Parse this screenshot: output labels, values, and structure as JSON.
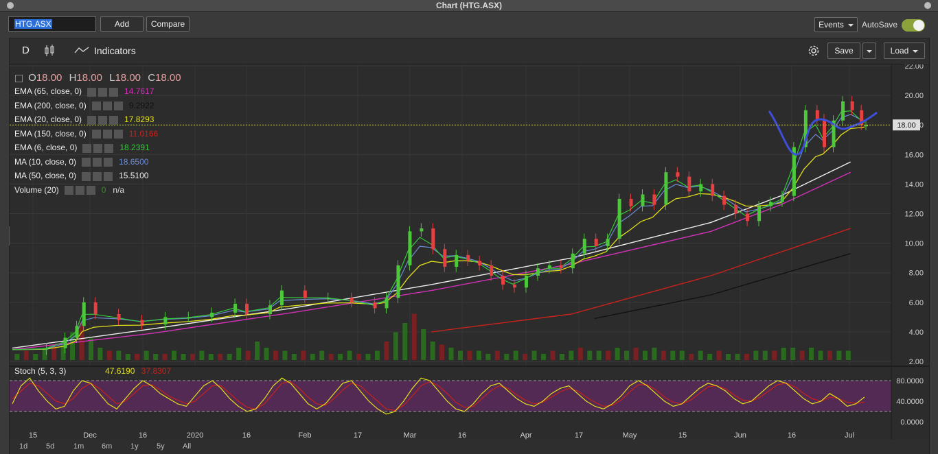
{
  "window": {
    "title": "Chart (HTG.ASX)"
  },
  "toolbar": {
    "symbol": "HTG.ASX",
    "add_label": "Add",
    "compare_label": "Compare",
    "events_label": "Events",
    "autosave_label": "AutoSave",
    "autosave_on": true
  },
  "chart_toolbar": {
    "period_label": "D",
    "indicators_label": "Indicators",
    "save_label": "Save",
    "load_label": "Load"
  },
  "ohlc": {
    "o_label": "O",
    "o": "18.00",
    "h_label": "H",
    "h": "18.00",
    "l_label": "L",
    "l": "18.00",
    "c_label": "C",
    "c": "18.00"
  },
  "legend": [
    {
      "label": "EMA (65, close, 0)",
      "value": "14.7617",
      "color": "#d231b8"
    },
    {
      "label": "EMA (200, close, 0)",
      "value": "9.2922",
      "color": "#111111"
    },
    {
      "label": "EMA (20, close, 0)",
      "value": "17.8293",
      "color": "#e3e01a"
    },
    {
      "label": "EMA (150, close, 0)",
      "value": "11.0166",
      "color": "#c8221c"
    },
    {
      "label": "EMA (6, close, 0)",
      "value": "18.2391",
      "color": "#35c83a"
    },
    {
      "label": "MA (10, close, 0)",
      "value": "18.6500",
      "color": "#6b8cd8"
    },
    {
      "label": "MA (50, close, 0)",
      "value": "15.5100",
      "color": "#eeeeee"
    },
    {
      "label": "Volume (20)",
      "value": "n/a",
      "value_prefix": "0",
      "color": "#3a8a2a"
    }
  ],
  "stoch_legend": {
    "label": "Stoch (5, 3, 3)",
    "k": "47.6190",
    "d": "37.8307",
    "k_color": "#e3e01a",
    "d_color": "#c8221c"
  },
  "range_buttons": [
    "1d",
    "5d",
    "1m",
    "6m",
    "1y",
    "5y",
    "All"
  ],
  "chart_data": {
    "type": "candlestick",
    "symbol": "HTG.ASX",
    "y_ticks": [
      "22.00",
      "20.00",
      "18.00",
      "16.00",
      "14.00",
      "12.00",
      "10.00",
      "8.00",
      "6.00",
      "4.00",
      "2.00"
    ],
    "ylim": [
      2,
      22
    ],
    "last_price_label": "18.00",
    "last_price": 18.0,
    "x_ticks": [
      "15",
      "Dec",
      "16",
      "2020",
      "16",
      "Feb",
      "17",
      "Mar",
      "16",
      "Apr",
      "17",
      "May",
      "15",
      "Jun",
      "16",
      "Jul"
    ],
    "price_path": [
      [
        0,
        2.8
      ],
      [
        14,
        2.9
      ],
      [
        22,
        3.6
      ],
      [
        27,
        4.4
      ],
      [
        30,
        6.0
      ],
      [
        35,
        5.2
      ],
      [
        45,
        4.8
      ],
      [
        55,
        4.5
      ],
      [
        65,
        5.0
      ],
      [
        75,
        5.0
      ],
      [
        85,
        5.3
      ],
      [
        95,
        5.9
      ],
      [
        100,
        5.2
      ],
      [
        110,
        5.8
      ],
      [
        115,
        6.8
      ],
      [
        125,
        6.3
      ],
      [
        135,
        6.3
      ],
      [
        145,
        6.0
      ],
      [
        155,
        5.6
      ],
      [
        160,
        6.3
      ],
      [
        165,
        8.5
      ],
      [
        170,
        10.8
      ],
      [
        175,
        11.0
      ],
      [
        180,
        9.6
      ],
      [
        185,
        8.4
      ],
      [
        190,
        9.2
      ],
      [
        195,
        8.8
      ],
      [
        200,
        8.5
      ],
      [
        205,
        7.8
      ],
      [
        210,
        7.2
      ],
      [
        215,
        7.0
      ],
      [
        220,
        7.8
      ],
      [
        225,
        8.3
      ],
      [
        230,
        8.5
      ],
      [
        235,
        8.3
      ],
      [
        240,
        9.3
      ],
      [
        245,
        10.3
      ],
      [
        250,
        9.8
      ],
      [
        255,
        10.3
      ],
      [
        260,
        13.0
      ],
      [
        265,
        12.5
      ],
      [
        270,
        13.3
      ],
      [
        275,
        12.6
      ],
      [
        280,
        14.8
      ],
      [
        285,
        14.5
      ],
      [
        290,
        13.5
      ],
      [
        295,
        14.0
      ],
      [
        300,
        13.2
      ],
      [
        305,
        12.6
      ],
      [
        310,
        12.0
      ],
      [
        315,
        11.5
      ],
      [
        320,
        12.5
      ],
      [
        325,
        12.8
      ],
      [
        330,
        13.2
      ],
      [
        335,
        16.5
      ],
      [
        340,
        19.0
      ],
      [
        345,
        18.4
      ],
      [
        348,
        16.5
      ],
      [
        352,
        18.3
      ],
      [
        356,
        19.6
      ],
      [
        360,
        19.0
      ],
      [
        364,
        18.0
      ],
      [
        366,
        18.0
      ]
    ],
    "volume_bars": [
      [
        1,
        0.2
      ],
      [
        5,
        0.3
      ],
      [
        9,
        0.2
      ],
      [
        13,
        0.4
      ],
      [
        17,
        0.5
      ],
      [
        21,
        0.6
      ],
      [
        25,
        0.9
      ],
      [
        29,
        1.2
      ],
      [
        33,
        0.7
      ],
      [
        37,
        0.4
      ],
      [
        41,
        0.3
      ],
      [
        45,
        0.3
      ],
      [
        49,
        0.2
      ],
      [
        53,
        0.2
      ],
      [
        57,
        0.3
      ],
      [
        61,
        0.2
      ],
      [
        65,
        0.2
      ],
      [
        69,
        0.3
      ],
      [
        73,
        0.2
      ],
      [
        77,
        0.2
      ],
      [
        81,
        0.3
      ],
      [
        85,
        0.2
      ],
      [
        89,
        0.2
      ],
      [
        93,
        0.2
      ],
      [
        97,
        0.4
      ],
      [
        101,
        0.3
      ],
      [
        105,
        0.6
      ],
      [
        109,
        0.4
      ],
      [
        113,
        0.3
      ],
      [
        117,
        0.3
      ],
      [
        121,
        0.2
      ],
      [
        125,
        0.3
      ],
      [
        129,
        0.2
      ],
      [
        133,
        0.3
      ],
      [
        137,
        0.2
      ],
      [
        141,
        0.2
      ],
      [
        145,
        0.3
      ],
      [
        149,
        0.2
      ],
      [
        153,
        0.2
      ],
      [
        157,
        0.3
      ],
      [
        161,
        0.6
      ],
      [
        165,
        0.9
      ],
      [
        169,
        1.2
      ],
      [
        173,
        1.5
      ],
      [
        177,
        1.0
      ],
      [
        181,
        0.6
      ],
      [
        185,
        0.5
      ],
      [
        189,
        0.4
      ],
      [
        193,
        0.3
      ],
      [
        197,
        0.3
      ],
      [
        201,
        0.3
      ],
      [
        205,
        0.2
      ],
      [
        209,
        0.3
      ],
      [
        213,
        0.2
      ],
      [
        217,
        0.3
      ],
      [
        221,
        0.2
      ],
      [
        225,
        0.3
      ],
      [
        229,
        0.2
      ],
      [
        233,
        0.3
      ],
      [
        237,
        0.2
      ],
      [
        241,
        0.3
      ],
      [
        245,
        0.4
      ],
      [
        249,
        0.3
      ],
      [
        253,
        0.3
      ],
      [
        257,
        0.3
      ],
      [
        261,
        0.4
      ],
      [
        265,
        0.3
      ],
      [
        269,
        0.4
      ],
      [
        273,
        0.3
      ],
      [
        277,
        0.4
      ],
      [
        281,
        0.3
      ],
      [
        285,
        0.3
      ],
      [
        289,
        0.3
      ],
      [
        293,
        0.2
      ],
      [
        297,
        0.3
      ],
      [
        301,
        0.2
      ],
      [
        305,
        0.3
      ],
      [
        309,
        0.2
      ],
      [
        313,
        0.2
      ],
      [
        317,
        0.2
      ],
      [
        321,
        0.3
      ],
      [
        325,
        0.3
      ],
      [
        329,
        0.3
      ],
      [
        333,
        0.4
      ],
      [
        337,
        0.4
      ],
      [
        341,
        0.3
      ],
      [
        345,
        0.4
      ],
      [
        349,
        0.3
      ],
      [
        353,
        0.3
      ],
      [
        357,
        0.3
      ],
      [
        361,
        0.3
      ]
    ],
    "indicator_lines": {
      "ema200": [
        [
          250,
          4.9
        ],
        [
          300,
          6.5
        ],
        [
          360,
          9.3
        ]
      ],
      "ema150": [
        [
          180,
          4.0
        ],
        [
          240,
          5.2
        ],
        [
          300,
          7.8
        ],
        [
          360,
          11.0
        ]
      ],
      "ema65": [
        [
          0,
          2.8
        ],
        [
          60,
          3.9
        ],
        [
          120,
          5.3
        ],
        [
          180,
          6.8
        ],
        [
          240,
          8.6
        ],
        [
          300,
          10.8
        ],
        [
          330,
          12.6
        ],
        [
          360,
          14.8
        ]
      ],
      "ma50": [
        [
          0,
          2.9
        ],
        [
          60,
          4.2
        ],
        [
          120,
          5.6
        ],
        [
          180,
          7.2
        ],
        [
          240,
          9.0
        ],
        [
          300,
          11.4
        ],
        [
          330,
          13.2
        ],
        [
          360,
          15.5
        ]
      ]
    },
    "stoch": {
      "yticks": [
        "80.0000",
        "40.0000",
        "0.0000"
      ],
      "ylim": [
        0,
        100
      ],
      "k_values": [
        35,
        70,
        85,
        60,
        40,
        25,
        30,
        60,
        80,
        75,
        55,
        35,
        25,
        45,
        65,
        80,
        70,
        55,
        45,
        35,
        30,
        50,
        70,
        80,
        65,
        45,
        30,
        20,
        25,
        45,
        70,
        85,
        75,
        55,
        35,
        25,
        35,
        55,
        75,
        80,
        60,
        40,
        25,
        15,
        20,
        40,
        65,
        85,
        80,
        60,
        40,
        25,
        20,
        35,
        55,
        70,
        75,
        60,
        45,
        35,
        30,
        40,
        55,
        65,
        70,
        55,
        40,
        30,
        25,
        35,
        50,
        70,
        80,
        70,
        55,
        40,
        30,
        35,
        50,
        65,
        75,
        70,
        60,
        45,
        35,
        40,
        55,
        70,
        80,
        75,
        60,
        45,
        35,
        40,
        55,
        45,
        30,
        35,
        48
      ],
      "d_values": [
        45,
        60,
        75,
        70,
        55,
        40,
        35,
        45,
        65,
        75,
        65,
        50,
        35,
        40,
        55,
        70,
        72,
        62,
        50,
        42,
        35,
        40,
        55,
        70,
        70,
        55,
        40,
        28,
        25,
        35,
        55,
        75,
        78,
        65,
        48,
        35,
        32,
        45,
        62,
        75,
        70,
        55,
        40,
        25,
        22,
        32,
        50,
        70,
        78,
        70,
        55,
        38,
        28,
        30,
        45,
        60,
        70,
        65,
        52,
        42,
        35,
        38,
        48,
        58,
        65,
        60,
        48,
        38,
        30,
        32,
        42,
        58,
        72,
        72,
        62,
        48,
        38,
        35,
        42,
        55,
        68,
        70,
        64,
        52,
        42,
        40,
        48,
        60,
        72,
        75,
        68,
        55,
        45,
        40,
        48,
        45,
        38,
        36,
        38
      ]
    }
  },
  "colors": {
    "up_candle": "#4dc83b",
    "down_candle": "#e84040",
    "vol_up": "#2a6a1e",
    "vol_down": "#7a1f22",
    "stoch_fill": "#5a2a5a",
    "drawn_curve": "#3d4fd8",
    "last_price_line": "#c8d21c"
  }
}
